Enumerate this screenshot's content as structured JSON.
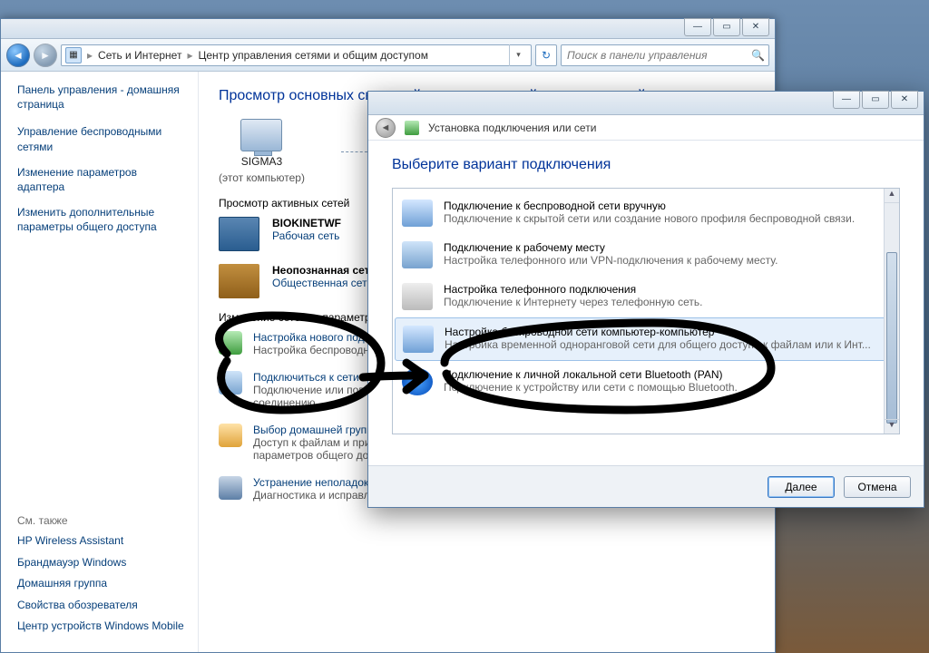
{
  "main_window": {
    "controls": {
      "min": "—",
      "max": "▭",
      "close": "✕"
    },
    "nav": {
      "back_glyph": "◄",
      "fwd_glyph": "►",
      "refresh_glyph": "↻"
    },
    "breadcrumb": {
      "lvl1": "Сеть и Интернет",
      "lvl2": "Центр управления сетями и общим доступом"
    },
    "search": {
      "placeholder": "Поиск в панели управления",
      "mag_glyph": "🔍"
    },
    "help_glyph": "?",
    "sidebar": {
      "home": "Панель управления - домашняя страница",
      "tasks": [
        "Управление беспроводными сетями",
        "Изменение параметров адаптера",
        "Изменить дополнительные параметры общего доступа"
      ],
      "seealso_h": "См. также",
      "seealso": [
        "HP Wireless Assistant",
        "Брандмауэр Windows",
        "Домашняя группа",
        "Свойства обозревателя",
        "Центр устройств Windows Mobile"
      ]
    },
    "content": {
      "h1": "Просмотр основных сведений о сети и настройка подключений",
      "map": {
        "pc_name": "SIGMA3",
        "pc_sub": "(этот компьютер)"
      },
      "active_h": "Просмотр активных сетей",
      "net1": {
        "name": "BIOKINETWF",
        "type": "Рабочая сеть"
      },
      "net2": {
        "name": "Неопознанная сеть",
        "type": "Общественная сеть"
      },
      "change_h": "Изменение сетевых параметров",
      "tasks": [
        {
          "title": "Настройка нового подключения или сети",
          "sub": "Настройка беспроводного, или же ..."
        },
        {
          "title": "Подключиться к сети",
          "sub": "Подключение или повторное подключение к беспроводному, проводному или сетевому соединению ..."
        },
        {
          "title": "Выбор домашней группы и ...",
          "sub": "Доступ к файлам и принтерам, расположенным на других сетевых компьютерах, или изменение параметров общего доступа."
        },
        {
          "title": "Устранение неполадок",
          "sub": "Диагностика и исправление сетевых проблем или получение сведений об исправлении."
        }
      ]
    }
  },
  "dialog": {
    "controls": {
      "min": "—",
      "max": "▭",
      "close": "✕"
    },
    "crumb": "Установка подключения или сети",
    "h1": "Выберите вариант подключения",
    "options": [
      {
        "title": "Подключение к беспроводной сети вручную",
        "sub": "Подключение к скрытой сети или создание нового профиля беспроводной связи."
      },
      {
        "title": "Подключение к рабочему месту",
        "sub": "Настройка телефонного или VPN-подключения к рабочему месту."
      },
      {
        "title": "Настройка телефонного подключения",
        "sub": "Подключение к Интернету через телефонную сеть."
      },
      {
        "title": "Настройка беспроводной сети компьютер-компьютер",
        "sub": "Настройка временной одноранговой сети для общего доступа к файлам или к Инт..."
      },
      {
        "title": "Подключение к личной локальной сети Bluetooth (PAN)",
        "sub": "Подключение к устройству или сети с помощью Bluetooth."
      }
    ],
    "buttons": {
      "next": "Далее",
      "cancel": "Отмена"
    }
  }
}
